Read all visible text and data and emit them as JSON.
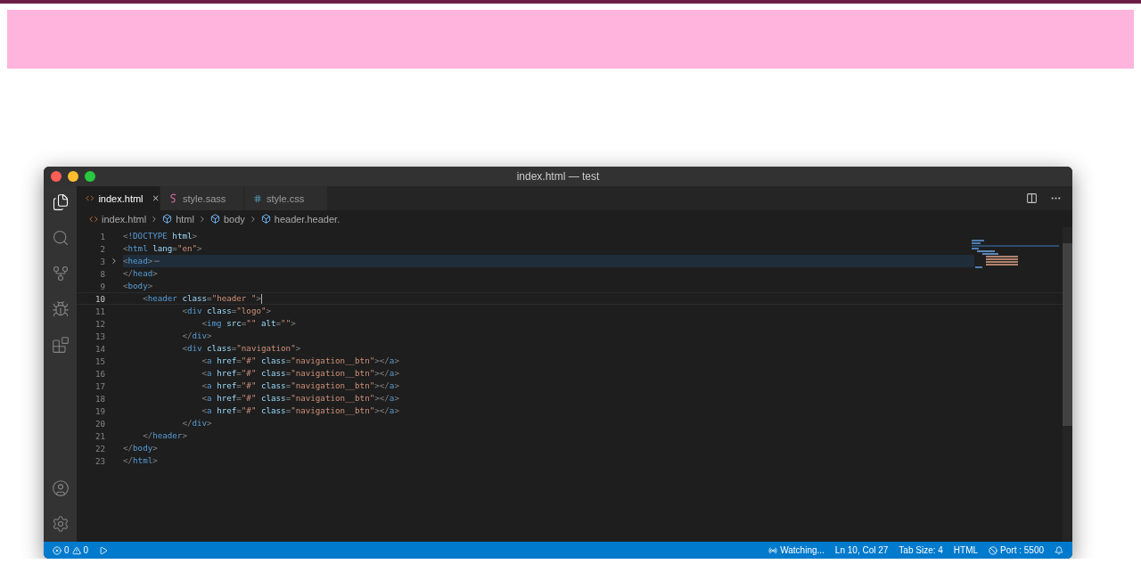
{
  "window": {
    "title": "index.html — test"
  },
  "tabs": [
    {
      "label": "index.html",
      "kind": "html",
      "selected": true
    },
    {
      "label": "style.sass",
      "kind": "sass",
      "selected": false
    },
    {
      "label": "style.css",
      "kind": "css",
      "selected": false
    }
  ],
  "breadcrumbs": [
    {
      "label": "index.html",
      "kind": "file"
    },
    {
      "label": "html",
      "kind": "element"
    },
    {
      "label": "body",
      "kind": "element"
    },
    {
      "label": "header.header.",
      "kind": "element"
    }
  ],
  "editor": {
    "lines": [
      {
        "number": "1",
        "folded": false,
        "current": false,
        "tokens": [
          {
            "kind": "punct",
            "text": "<"
          },
          {
            "kind": "tag",
            "text": "!DOCTYPE"
          },
          {
            "kind": "attr",
            "text": " html"
          },
          {
            "kind": "punct",
            "text": ">"
          }
        ]
      },
      {
        "number": "2",
        "folded": false,
        "current": false,
        "tokens": [
          {
            "kind": "punct",
            "text": "<"
          },
          {
            "kind": "tag",
            "text": "html"
          },
          {
            "kind": "attr",
            "text": " lang"
          },
          {
            "kind": "punct",
            "text": "="
          },
          {
            "kind": "string",
            "text": "\"en\""
          },
          {
            "kind": "punct",
            "text": ">"
          }
        ]
      },
      {
        "number": "3",
        "folded": true,
        "fold_mark": "⋯",
        "current": false,
        "tokens": [
          {
            "kind": "punct",
            "text": "<"
          },
          {
            "kind": "tag",
            "text": "head"
          },
          {
            "kind": "punct",
            "text": ">"
          }
        ]
      },
      {
        "number": "8",
        "folded": false,
        "current": false,
        "tokens": [
          {
            "kind": "punct",
            "text": "</"
          },
          {
            "kind": "tag",
            "text": "head"
          },
          {
            "kind": "punct",
            "text": ">"
          }
        ]
      },
      {
        "number": "9",
        "folded": false,
        "current": false,
        "tokens": [
          {
            "kind": "punct",
            "text": "<"
          },
          {
            "kind": "tag",
            "text": "body"
          },
          {
            "kind": "punct",
            "text": ">"
          }
        ]
      },
      {
        "number": "10",
        "folded": false,
        "current": true,
        "tokens": [
          {
            "kind": "punct",
            "text": "    <"
          },
          {
            "kind": "tag",
            "text": "header"
          },
          {
            "kind": "attr",
            "text": " class"
          },
          {
            "kind": "punct",
            "text": "="
          },
          {
            "kind": "string",
            "text": "\"header \""
          },
          {
            "kind": "punct",
            "text": ">"
          }
        ]
      },
      {
        "number": "11",
        "folded": false,
        "current": false,
        "tokens": [
          {
            "kind": "punct",
            "text": "            <"
          },
          {
            "kind": "tag",
            "text": "div"
          },
          {
            "kind": "attr",
            "text": " class"
          },
          {
            "kind": "punct",
            "text": "="
          },
          {
            "kind": "string",
            "text": "\"logo\""
          },
          {
            "kind": "punct",
            "text": ">"
          }
        ]
      },
      {
        "number": "12",
        "folded": false,
        "current": false,
        "tokens": [
          {
            "kind": "punct",
            "text": "                <"
          },
          {
            "kind": "tag",
            "text": "img"
          },
          {
            "kind": "attr",
            "text": " src"
          },
          {
            "kind": "punct",
            "text": "="
          },
          {
            "kind": "string",
            "text": "\"\""
          },
          {
            "kind": "attr",
            "text": " alt"
          },
          {
            "kind": "punct",
            "text": "="
          },
          {
            "kind": "string",
            "text": "\"\""
          },
          {
            "kind": "punct",
            "text": ">"
          }
        ]
      },
      {
        "number": "13",
        "folded": false,
        "current": false,
        "tokens": [
          {
            "kind": "punct",
            "text": "            </"
          },
          {
            "kind": "tag",
            "text": "div"
          },
          {
            "kind": "punct",
            "text": ">"
          }
        ]
      },
      {
        "number": "14",
        "folded": false,
        "current": false,
        "tokens": [
          {
            "kind": "punct",
            "text": "            <"
          },
          {
            "kind": "tag",
            "text": "div"
          },
          {
            "kind": "attr",
            "text": " class"
          },
          {
            "kind": "punct",
            "text": "="
          },
          {
            "kind": "string",
            "text": "\"navigation\""
          },
          {
            "kind": "punct",
            "text": ">"
          }
        ]
      },
      {
        "number": "15",
        "folded": false,
        "current": false,
        "tokens": [
          {
            "kind": "punct",
            "text": "                <"
          },
          {
            "kind": "tag",
            "text": "a"
          },
          {
            "kind": "attr",
            "text": " href"
          },
          {
            "kind": "punct",
            "text": "="
          },
          {
            "kind": "string",
            "text": "\"#\""
          },
          {
            "kind": "attr",
            "text": " class"
          },
          {
            "kind": "punct",
            "text": "="
          },
          {
            "kind": "string",
            "text": "\"navigation__btn\""
          },
          {
            "kind": "punct",
            "text": "></"
          },
          {
            "kind": "tag",
            "text": "a"
          },
          {
            "kind": "punct",
            "text": ">"
          }
        ]
      },
      {
        "number": "16",
        "folded": false,
        "current": false,
        "tokens": [
          {
            "kind": "punct",
            "text": "                <"
          },
          {
            "kind": "tag",
            "text": "a"
          },
          {
            "kind": "attr",
            "text": " href"
          },
          {
            "kind": "punct",
            "text": "="
          },
          {
            "kind": "string",
            "text": "\"#\""
          },
          {
            "kind": "attr",
            "text": " class"
          },
          {
            "kind": "punct",
            "text": "="
          },
          {
            "kind": "string",
            "text": "\"navigation__btn\""
          },
          {
            "kind": "punct",
            "text": "></"
          },
          {
            "kind": "tag",
            "text": "a"
          },
          {
            "kind": "punct",
            "text": ">"
          }
        ]
      },
      {
        "number": "17",
        "folded": false,
        "current": false,
        "tokens": [
          {
            "kind": "punct",
            "text": "                <"
          },
          {
            "kind": "tag",
            "text": "a"
          },
          {
            "kind": "attr",
            "text": " href"
          },
          {
            "kind": "punct",
            "text": "="
          },
          {
            "kind": "string",
            "text": "\"#\""
          },
          {
            "kind": "attr",
            "text": " class"
          },
          {
            "kind": "punct",
            "text": "="
          },
          {
            "kind": "string",
            "text": "\"navigation__btn\""
          },
          {
            "kind": "punct",
            "text": "></"
          },
          {
            "kind": "tag",
            "text": "a"
          },
          {
            "kind": "punct",
            "text": ">"
          }
        ]
      },
      {
        "number": "18",
        "folded": false,
        "current": false,
        "tokens": [
          {
            "kind": "punct",
            "text": "                <"
          },
          {
            "kind": "tag",
            "text": "a"
          },
          {
            "kind": "attr",
            "text": " href"
          },
          {
            "kind": "punct",
            "text": "="
          },
          {
            "kind": "string",
            "text": "\"#\""
          },
          {
            "kind": "attr",
            "text": " class"
          },
          {
            "kind": "punct",
            "text": "="
          },
          {
            "kind": "string",
            "text": "\"navigation__btn\""
          },
          {
            "kind": "punct",
            "text": "></"
          },
          {
            "kind": "tag",
            "text": "a"
          },
          {
            "kind": "punct",
            "text": ">"
          }
        ]
      },
      {
        "number": "19",
        "folded": false,
        "current": false,
        "tokens": [
          {
            "kind": "punct",
            "text": "                <"
          },
          {
            "kind": "tag",
            "text": "a"
          },
          {
            "kind": "attr",
            "text": " href"
          },
          {
            "kind": "punct",
            "text": "="
          },
          {
            "kind": "string",
            "text": "\"#\""
          },
          {
            "kind": "attr",
            "text": " class"
          },
          {
            "kind": "punct",
            "text": "="
          },
          {
            "kind": "string",
            "text": "\"navigation__btn\""
          },
          {
            "kind": "punct",
            "text": "></"
          },
          {
            "kind": "tag",
            "text": "a"
          },
          {
            "kind": "punct",
            "text": ">"
          }
        ]
      },
      {
        "number": "20",
        "folded": false,
        "current": false,
        "tokens": [
          {
            "kind": "punct",
            "text": "            </"
          },
          {
            "kind": "tag",
            "text": "div"
          },
          {
            "kind": "punct",
            "text": ">"
          }
        ]
      },
      {
        "number": "21",
        "folded": false,
        "current": false,
        "tokens": [
          {
            "kind": "punct",
            "text": "    </"
          },
          {
            "kind": "tag",
            "text": "header"
          },
          {
            "kind": "punct",
            "text": ">"
          }
        ]
      },
      {
        "number": "22",
        "folded": false,
        "current": false,
        "tokens": [
          {
            "kind": "punct",
            "text": "</"
          },
          {
            "kind": "tag",
            "text": "body"
          },
          {
            "kind": "punct",
            "text": ">"
          }
        ]
      },
      {
        "number": "23",
        "folded": false,
        "current": false,
        "tokens": [
          {
            "kind": "punct",
            "text": "</"
          },
          {
            "kind": "tag",
            "text": "html"
          },
          {
            "kind": "punct",
            "text": ">"
          }
        ]
      }
    ]
  },
  "status_bar": {
    "errors": "0",
    "warnings": "0",
    "right": [
      {
        "kind": "watch",
        "text": "Watching..."
      },
      {
        "kind": "plain",
        "text": "Ln 10, Col 27"
      },
      {
        "kind": "plain",
        "text": "Tab Size: 4"
      },
      {
        "kind": "plain",
        "text": "HTML"
      },
      {
        "kind": "port",
        "text": "Port : 5500"
      },
      {
        "kind": "bell"
      }
    ]
  }
}
